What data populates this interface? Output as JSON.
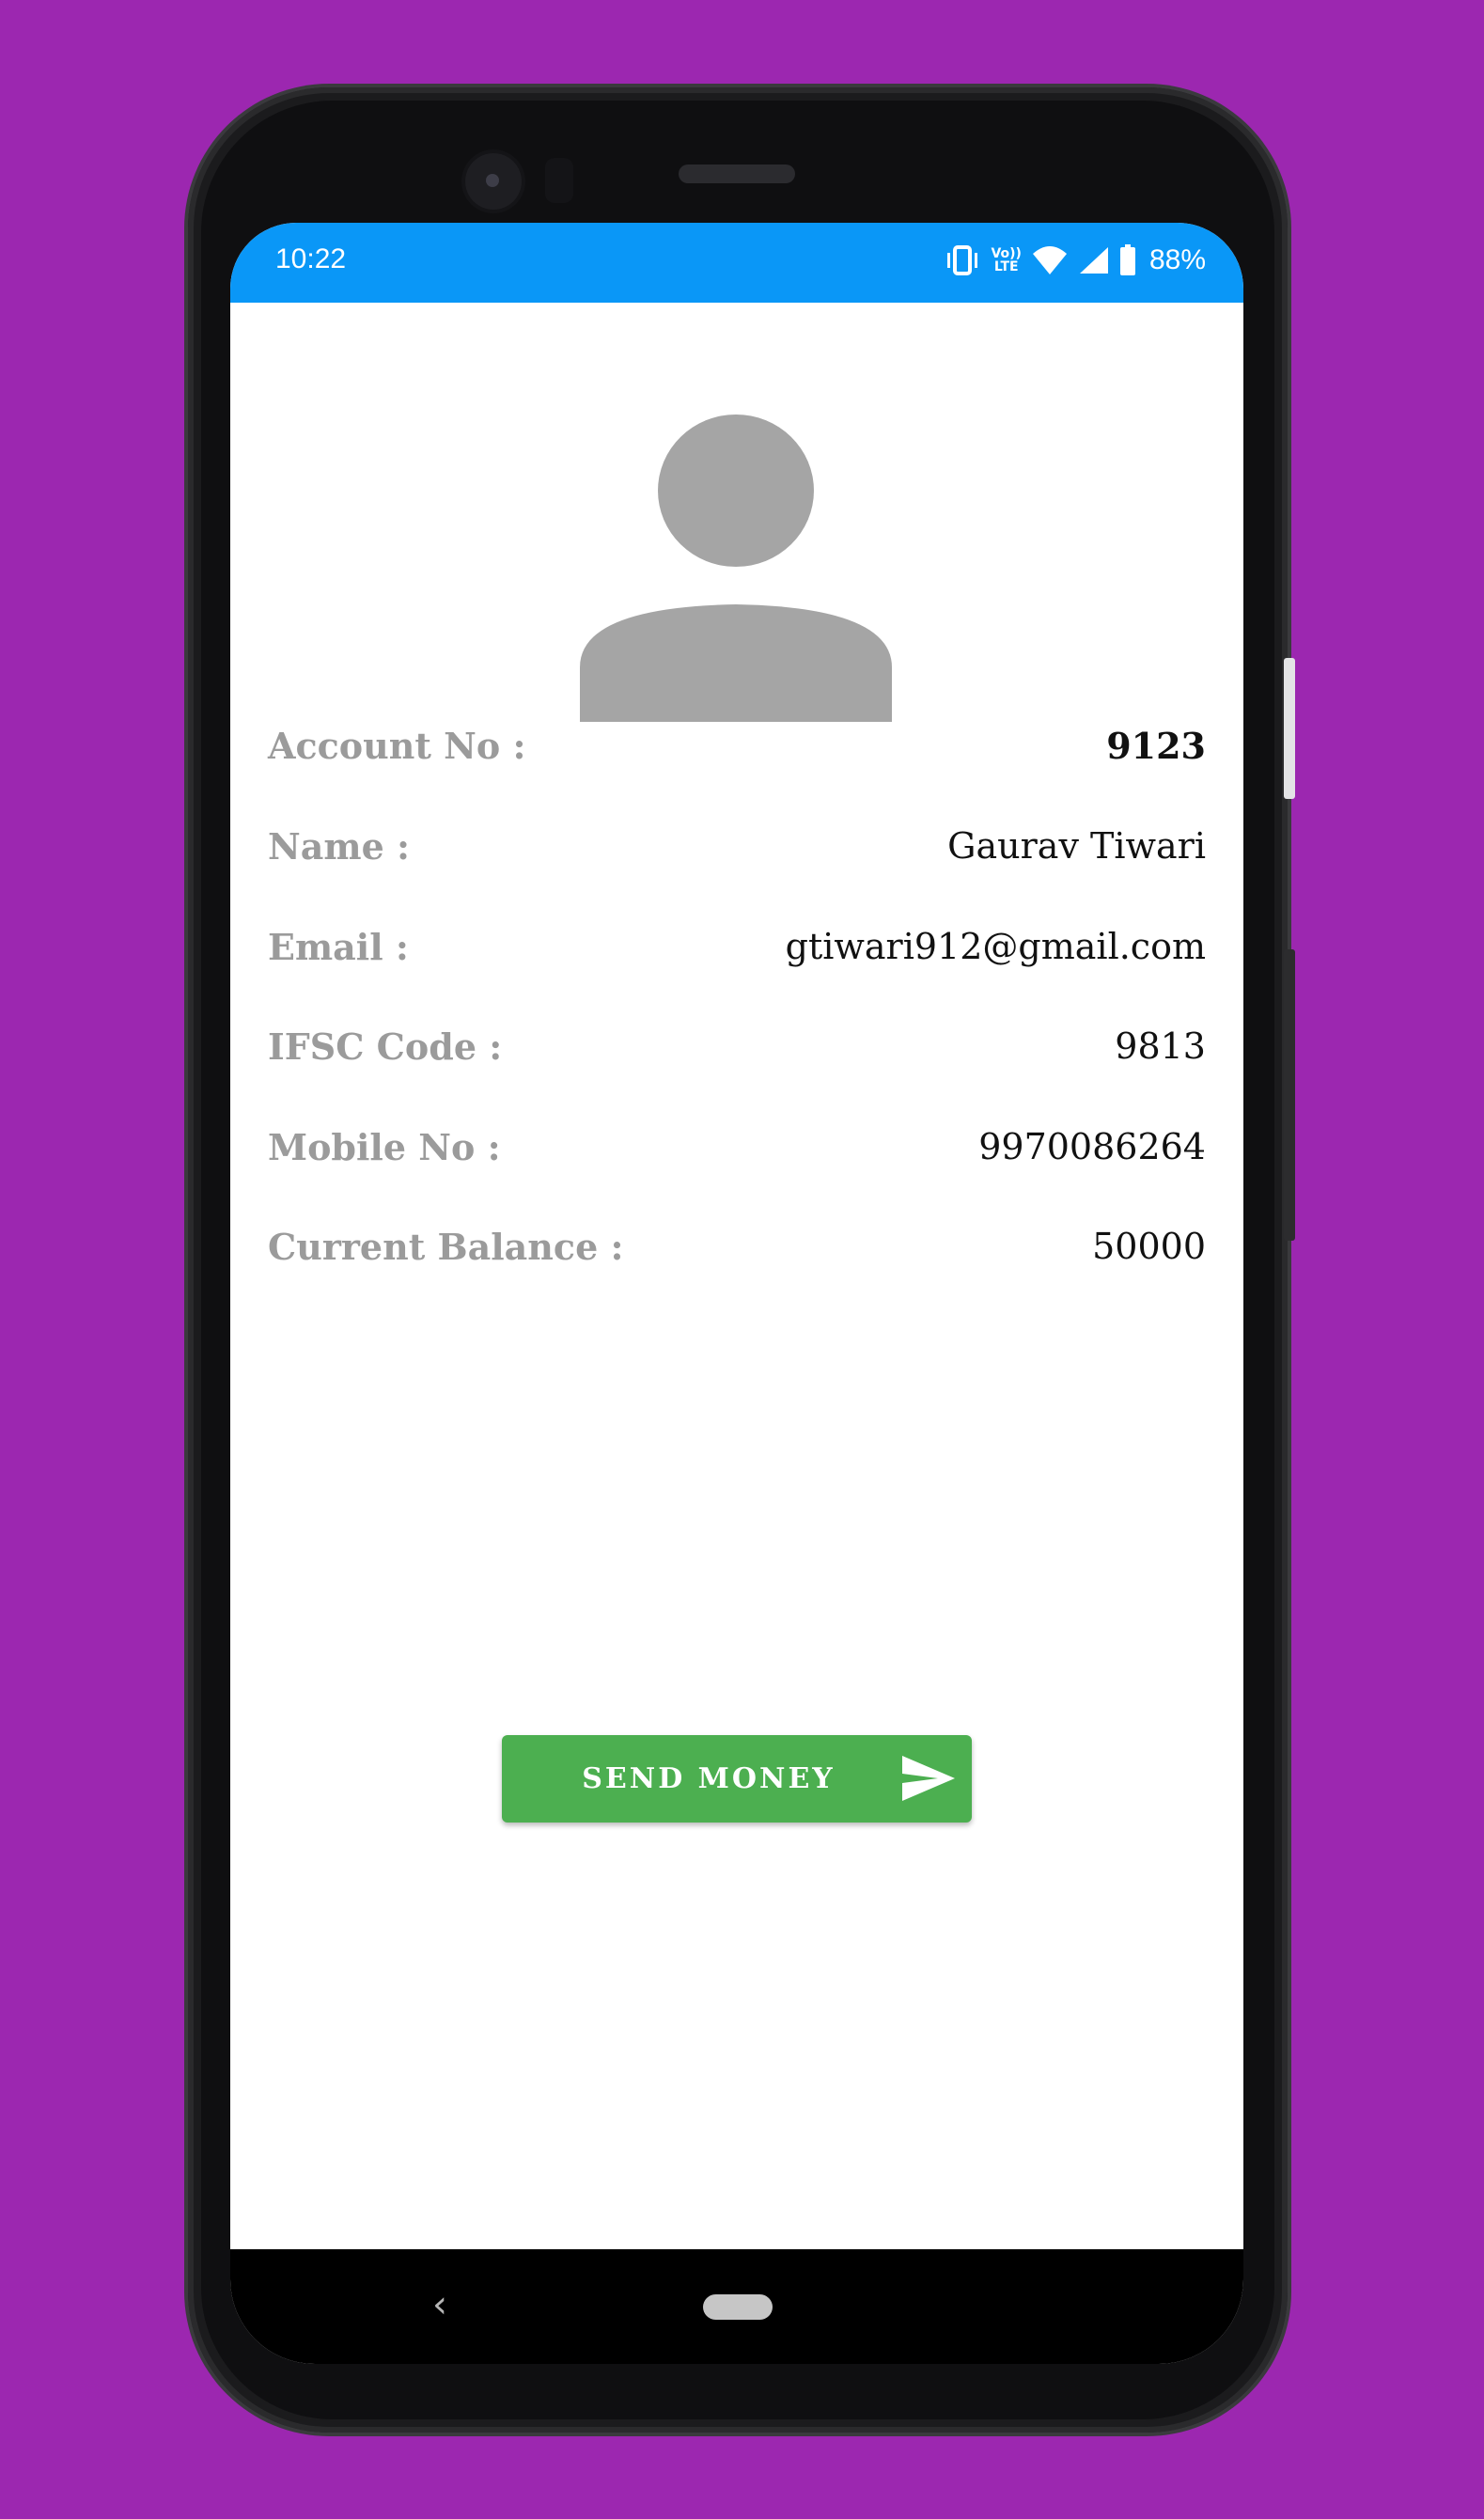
{
  "status_bar": {
    "time": "10:22",
    "lte_top": "Vo))",
    "lte_bottom": "LTE",
    "battery_percent": "88%",
    "background": "#0A97F7",
    "icons": [
      "vibrate-icon",
      "volte-icon",
      "wifi-icon",
      "cell-signal-icon",
      "battery-icon"
    ]
  },
  "profile": {
    "avatar_icon": "person-placeholder-icon",
    "rows": [
      {
        "label": "Account No :",
        "value": "9123"
      },
      {
        "label": "Name :",
        "value": "Gaurav Tiwari"
      },
      {
        "label": "Email :",
        "value": "gtiwari912@gmail.com"
      },
      {
        "label": "IFSC Code :",
        "value": "9813"
      },
      {
        "label": "Mobile No :",
        "value": "9970086264"
      },
      {
        "label": "Current Balance :",
        "value": "50000"
      }
    ]
  },
  "actions": {
    "send_money_label": "SEND MONEY",
    "send_icon": "send-icon",
    "button_color": "#4CAF50"
  },
  "navigation": {
    "back_glyph": "‹",
    "icons": [
      "back-icon",
      "home-pill-icon"
    ]
  },
  "theme": {
    "page_background": "#9C27B0",
    "label_color": "#9b9b9b"
  }
}
